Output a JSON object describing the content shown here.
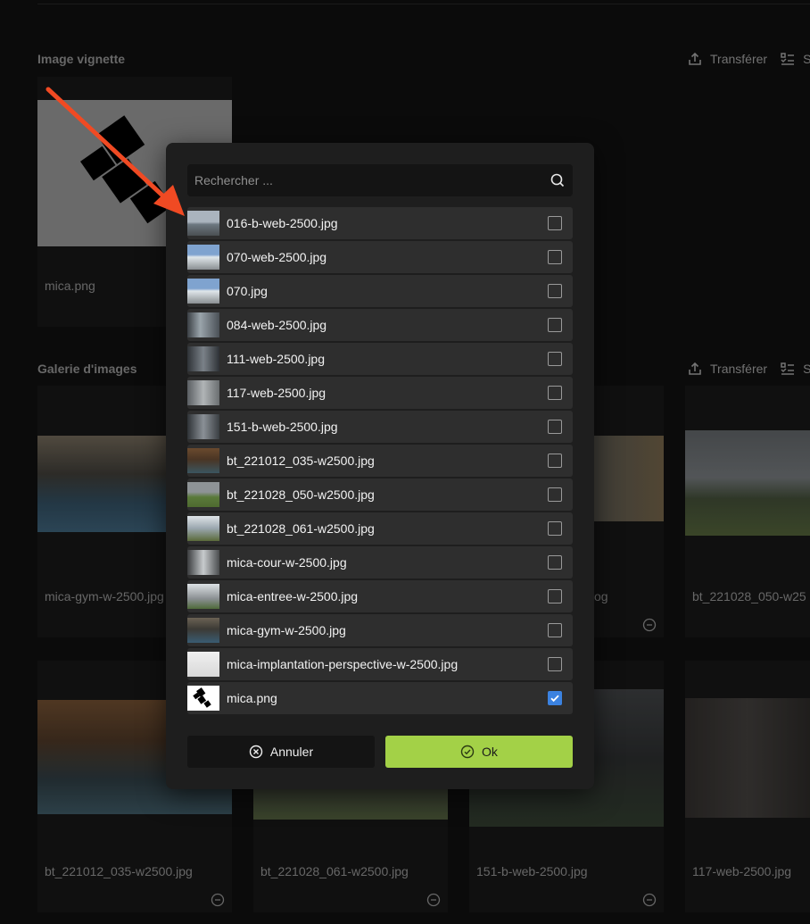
{
  "thumbnail_section": {
    "title": "Image vignette",
    "upload_label": "Transférer",
    "select_label": "S",
    "card": {
      "caption": "mica.png"
    }
  },
  "gallery_section": {
    "title": "Galerie d'images",
    "upload_label": "Transférer",
    "select_label": "S",
    "cards_row1": [
      {
        "caption": "mica-gym-w-2500.jpg"
      },
      {
        "caption": "og"
      },
      {
        "caption": "bt_221028_050-w25"
      }
    ],
    "cards_row2": [
      {
        "caption": "bt_221012_035-w2500.jpg"
      },
      {
        "caption": "bt_221028_061-w2500.jpg"
      },
      {
        "caption": "151-b-web-2500.jpg"
      },
      {
        "caption": "117-web-2500.jpg"
      }
    ]
  },
  "dialog": {
    "search_placeholder": "Rechercher ...",
    "items": [
      {
        "name": "016-b-web-2500.jpg",
        "checked": false
      },
      {
        "name": "070-web-2500.jpg",
        "checked": false
      },
      {
        "name": "070.jpg",
        "checked": false
      },
      {
        "name": "084-web-2500.jpg",
        "checked": false
      },
      {
        "name": "111-web-2500.jpg",
        "checked": false
      },
      {
        "name": "117-web-2500.jpg",
        "checked": false
      },
      {
        "name": "151-b-web-2500.jpg",
        "checked": false
      },
      {
        "name": "bt_221012_035-w2500.jpg",
        "checked": false
      },
      {
        "name": "bt_221028_050-w2500.jpg",
        "checked": false
      },
      {
        "name": "bt_221028_061-w2500.jpg",
        "checked": false
      },
      {
        "name": "mica-cour-w-2500.jpg",
        "checked": false
      },
      {
        "name": "mica-entree-w-2500.jpg",
        "checked": false
      },
      {
        "name": "mica-gym-w-2500.jpg",
        "checked": false
      },
      {
        "name": "mica-implantation-perspective-w-2500.jpg",
        "checked": false
      },
      {
        "name": "mica.png",
        "checked": true
      }
    ],
    "cancel_label": "Annuler",
    "ok_label": "Ok"
  },
  "colors": {
    "accent_ok": "#a3d147",
    "checkbox_checked": "#3b82e0",
    "annotation_arrow": "#f04a23"
  }
}
